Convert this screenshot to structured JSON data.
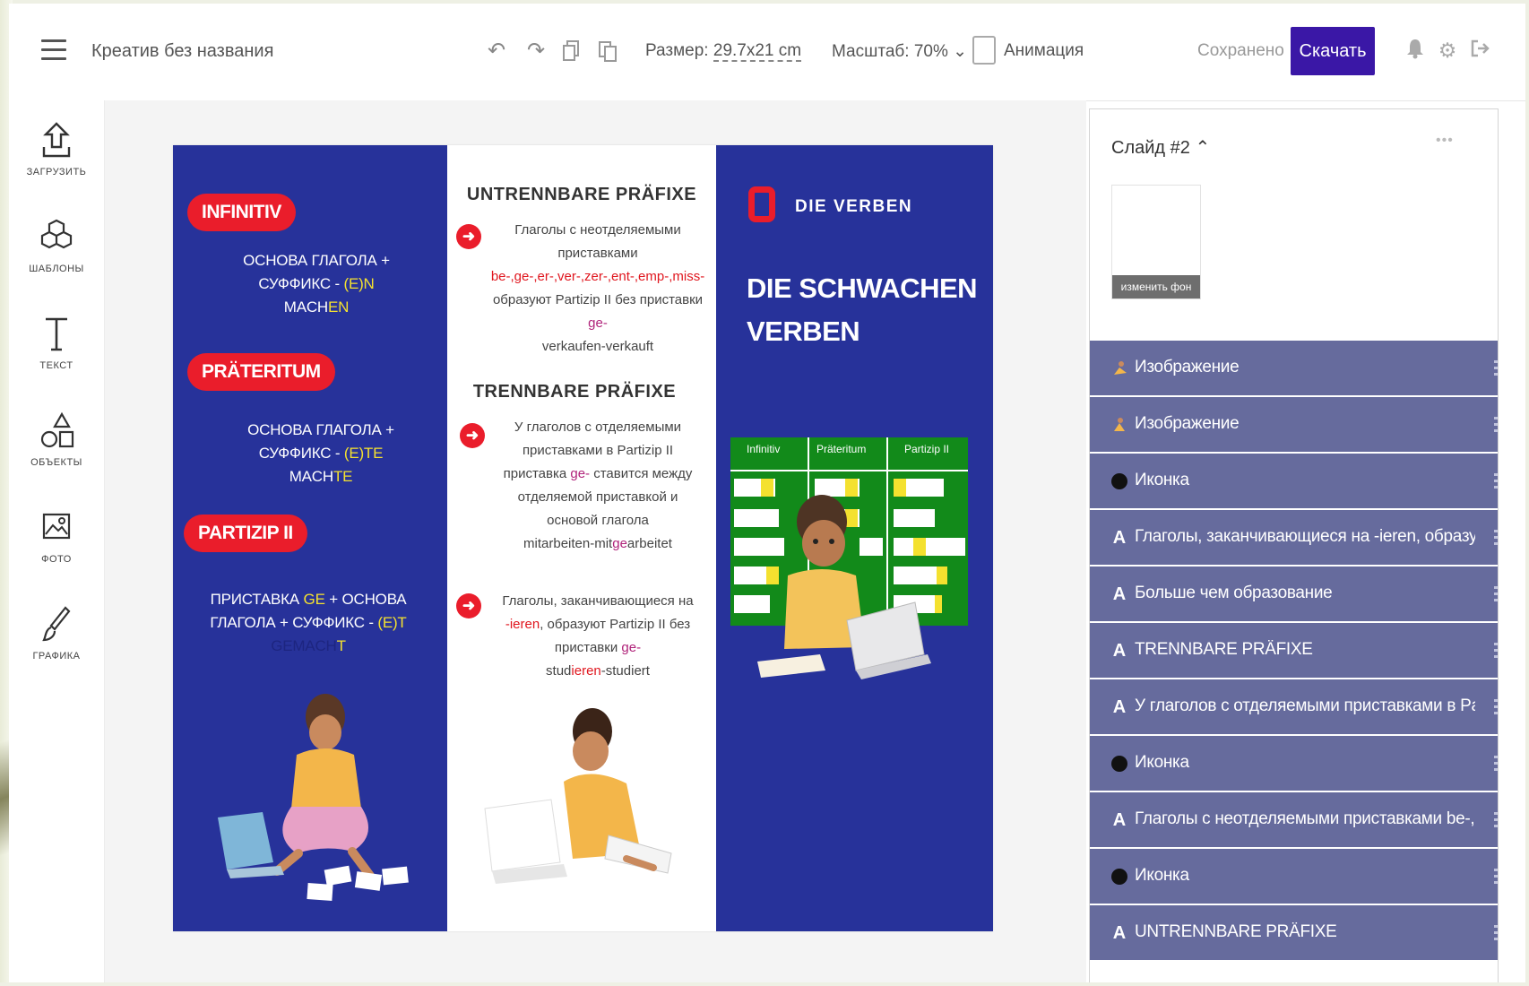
{
  "topbar": {
    "title": "Креатив без названия",
    "size_label": "Размер: ",
    "size_value": "29.7x21 cm",
    "scale_label": "Масштаб: 70% ⌄",
    "animation_label": "Анимация",
    "saved_label": "Сохранено",
    "download_label": "Скачать"
  },
  "sidebar": {
    "items": [
      {
        "label": "ЗАГРУЗИТЬ"
      },
      {
        "label": "ШАБЛОНЫ"
      },
      {
        "label": "ТЕКСТ"
      },
      {
        "label": "ОБЪЕКТЫ"
      },
      {
        "label": "ФОТО"
      },
      {
        "label": "ГРАФИКА"
      }
    ]
  },
  "canvas": {
    "panel_a": {
      "infinitiv": "INFINITIV",
      "infinitiv_rule1": "ОСНОВА ГЛАГОЛА +",
      "infinitiv_rule2a": "СУФФИКС - ",
      "infinitiv_rule2b": "(E)N",
      "infinitiv_rule3a": "MACH",
      "infinitiv_rule3b": "EN",
      "prateritum": "PRÄTERITUM",
      "prat_rule1": "ОСНОВА ГЛАГОЛА +",
      "prat_rule2a": "СУФФИКС - ",
      "prat_rule2b": "(E)TE",
      "prat_rule3a": "MACH",
      "prat_rule3b": "TE",
      "partizip": "PARTIZIP II",
      "part_rule1a": "ПРИСТАВКА ",
      "part_rule1b": "GE",
      "part_rule1c": " + ОСНОВА",
      "part_rule2a": "ГЛАГОЛА + СУФФИКС - ",
      "part_rule2b": "(E)T",
      "part_rule3a": "GEMACH",
      "part_rule3b": "T"
    },
    "panel_b": {
      "heading1": "UNTRENNBARE PRÄFIXE",
      "p1_line1": "Глаголы с неотделяемыми",
      "p1_line2": "приставками",
      "p1_line3": "be-,ge-,er-,ver-,zer-,ent-,emp-,miss-",
      "p1_line4": "образуют Partizip II без приставки",
      "p1_line5": "ge-",
      "p1_line6": "verkaufen-verkauft",
      "heading2": "TRENNBARE PRÄFIXE",
      "p2_line1": "У глаголов с отделяемыми",
      "p2_line2": "приставками  в Partizip II",
      "p2_line3a": "приставка ",
      "p2_line3b": "ge-",
      "p2_line3c": " ставится между",
      "p2_line4": "отделяемой приставкой и",
      "p2_line5": "основой глагола",
      "p2_line6a": "mitarbeiten-mit",
      "p2_line6b": "ge",
      "p2_line6c": "arbeitet",
      "p3_line1": "Глаголы, заканчивающиеся на",
      "p3_line2a": "-ieren",
      "p3_line2b": ", образуют Partizip II  без",
      "p3_line3a": "приставки ",
      "p3_line3b": "ge-",
      "p3_line4a": "stud",
      "p3_line4b": "ieren",
      "p3_line4c": "-studiert"
    },
    "panel_c": {
      "logo_text": "DIE VERBEN",
      "title_line1": "DIE SCHWACHEN",
      "title_line2": "VERBEN",
      "table_headers": [
        "Infinitiv",
        "Präteritum",
        "Partizip II"
      ]
    }
  },
  "right_panel": {
    "slide_title": "Слайд #2 ⌃",
    "more": "•••",
    "change_bg": "изменить фон",
    "layers": [
      {
        "type": "image",
        "name": "Изображение"
      },
      {
        "type": "image",
        "name": "Изображение"
      },
      {
        "type": "icon",
        "name": "Иконка"
      },
      {
        "type": "text",
        "name": "Глаголы, заканчивающиеся на -ieren, образуют Partizip"
      },
      {
        "type": "text",
        "name": "Больше чем образование"
      },
      {
        "type": "text",
        "name": "TRENNBARE PRÄFIXE"
      },
      {
        "type": "text",
        "name": "У глаголов с отделяемыми приставками  в Partizip II"
      },
      {
        "type": "icon",
        "name": "Иконка"
      },
      {
        "type": "text",
        "name": "Глаголы с неотделяемыми приставками be-,ge-,er-,ver-"
      },
      {
        "type": "icon",
        "name": "Иконка"
      },
      {
        "type": "text",
        "name": "UNTRENNBARE PRÄFIXE"
      }
    ],
    "text_layer_glyph": "A"
  },
  "colors": {
    "accent": "#3a17a6",
    "panel_blue": "#27329a",
    "pill_red": "#ea1d2b",
    "highlight_yellow": "#f4e12f",
    "layer_bg": "#666b9d",
    "table_green": "#128a1a"
  }
}
